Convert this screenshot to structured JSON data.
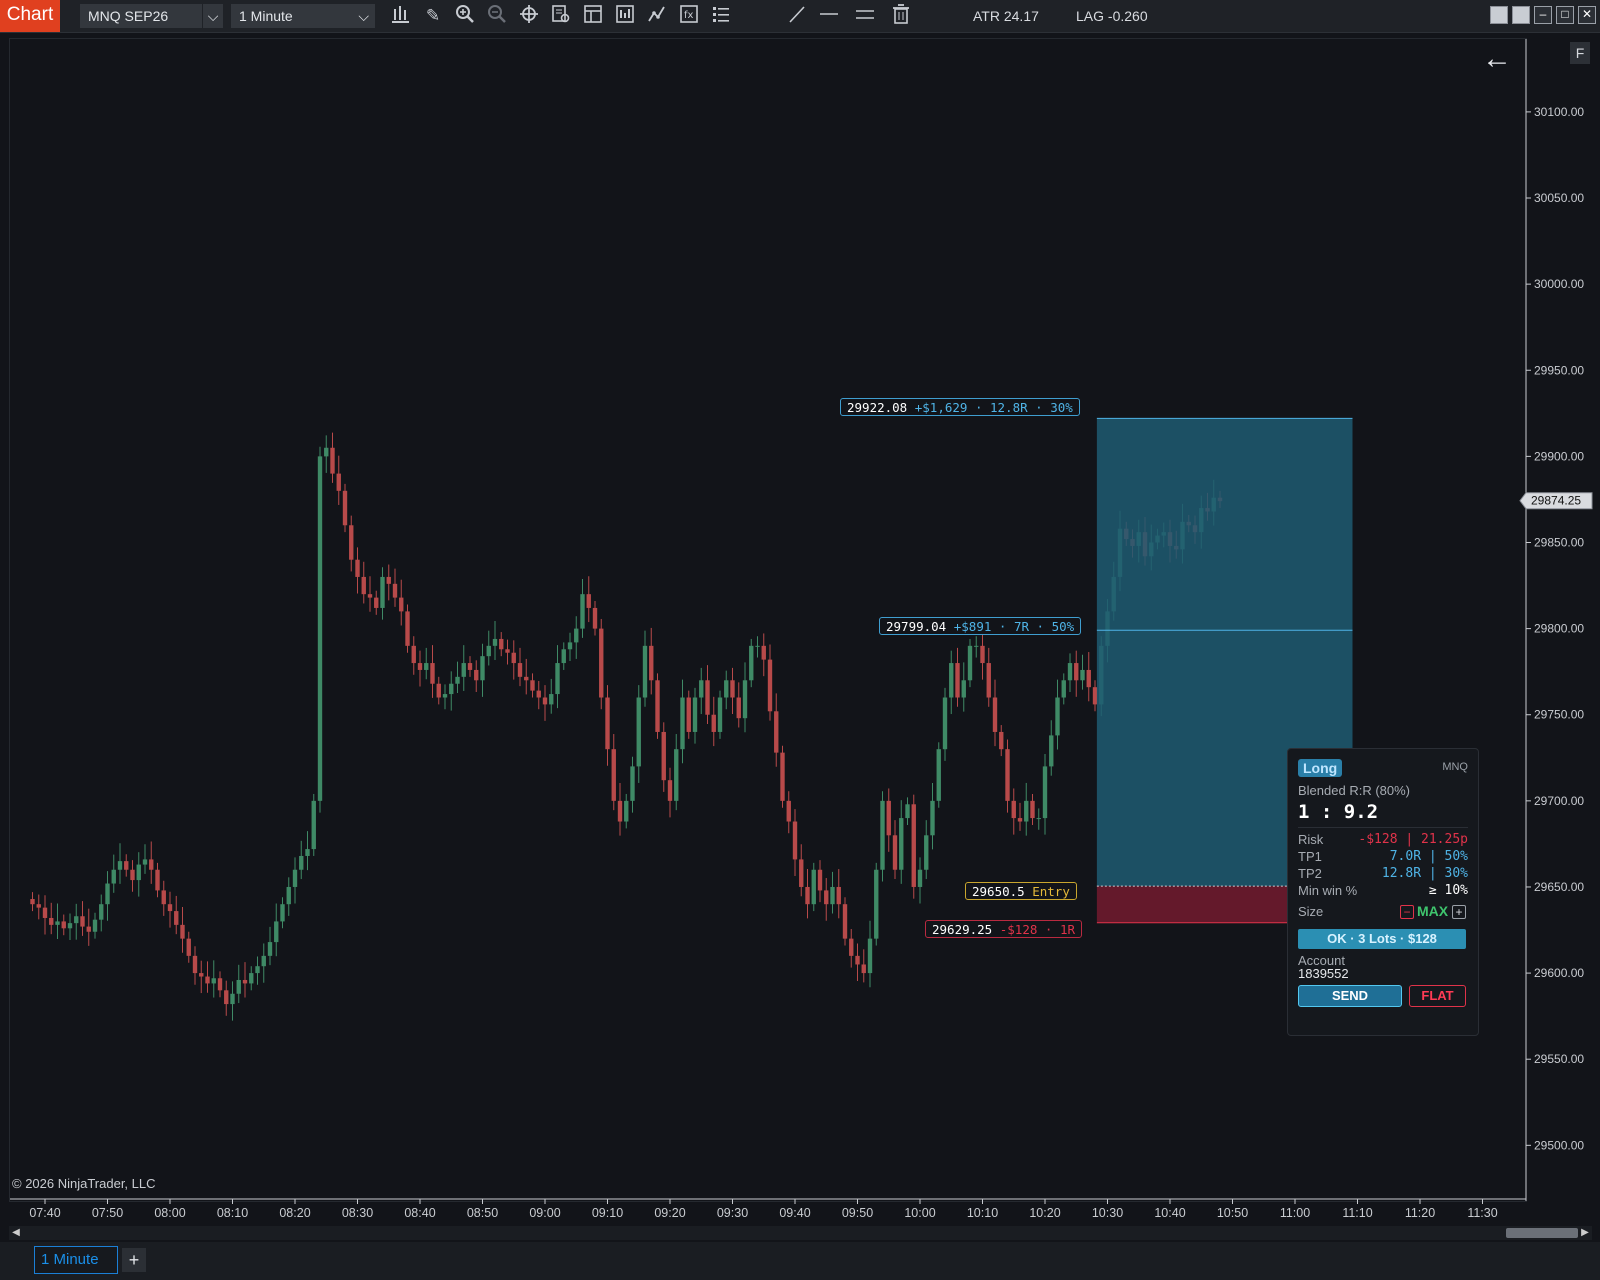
{
  "toolbar": {
    "chart_tab": "Chart",
    "instrument": "MNQ SEP26",
    "interval": "1 Minute",
    "atr": "ATR 24.17",
    "lag": "LAG -0.260",
    "tool_icons": [
      "bars-type-icon",
      "pencil-icon",
      "zoom-in-icon",
      "zoom-out-icon",
      "crosshair-icon",
      "data-box-icon",
      "properties-icon",
      "templates-icon",
      "strategies-icon",
      "indicators-icon",
      "list-icon",
      "draw-line-icon",
      "horizontal-line-icon",
      "double-line-icon",
      "trash-icon"
    ]
  },
  "colors": {
    "up": "#3f8a66",
    "down": "#b84a4a",
    "background": "#121419",
    "target_zone": "#1f5a72",
    "stop_zone": "#6e1a2e",
    "accent_blue": "#4fb3e6",
    "entry_yellow": "#e4b93a",
    "risk_red": "#e0334a"
  },
  "f_button": "F",
  "copyright": "© 2026 NinjaTrader, LLC",
  "bottom": {
    "tab_label": "1 Minute",
    "add_tab": "+"
  },
  "levels": {
    "tp2": {
      "price_text": "29922.08",
      "detail": "+$1,629 · 12.8R · 30%"
    },
    "tp1": {
      "price_text": "29799.04",
      "detail": "+$891 · 7R · 50%"
    },
    "entry": {
      "price_text": "29650.5",
      "detail": "Entry"
    },
    "stop": {
      "price_text": "29629.25",
      "detail": "-$128 · 1R"
    }
  },
  "last_price_label": "29874.25",
  "order_panel": {
    "side": "Long",
    "symbol": "MNQ",
    "blended_label": "Blended R:R (80%)",
    "ratio": "1 : 9.2",
    "risk_label": "Risk",
    "risk_dollars": "-$128",
    "risk_points": "21.25p",
    "tp1_label": "TP1",
    "tp1_r": "7.0R",
    "tp1_pct": "50%",
    "tp2_label": "TP2",
    "tp2_r": "12.8R",
    "tp2_pct": "30%",
    "minwin_label": "Min win %",
    "minwin_value": "≥ 10%",
    "size_label": "Size",
    "size_value": "MAX",
    "size_minus": "−",
    "size_plus": "+",
    "ok_text": "OK · 3 Lots · $128",
    "account_label": "Account",
    "account_value": "1839552",
    "send": "SEND",
    "flat": "FLAT"
  },
  "chart_data": {
    "type": "candlestick",
    "instrument": "MNQ SEP26",
    "interval": "1 Minute",
    "ylim": [
      29470,
      30140
    ],
    "yticks": [
      30100,
      30050,
      30000,
      29950,
      29900,
      29850,
      29800,
      29750,
      29700,
      29650,
      29600,
      29550,
      29500
    ],
    "ytick_labels": [
      "30100.00",
      "30050.00",
      "30000.00",
      "29950.00",
      "29900.00",
      "29850.00",
      "29800.00",
      "29750.00",
      "29700.00",
      "29650.00",
      "29600.00",
      "29550.00",
      "29500.00"
    ],
    "xticks": [
      "07:40",
      "07:50",
      "08:00",
      "08:10",
      "08:20",
      "08:30",
      "08:40",
      "08:50",
      "09:00",
      "09:10",
      "09:20",
      "09:30",
      "09:40",
      "09:50",
      "10:00",
      "10:10",
      "10:20",
      "10:30",
      "10:40",
      "10:50",
      "11:00",
      "11:10",
      "11:20",
      "11:30"
    ],
    "time_start": "07:38",
    "last_close": 29874.25,
    "bars_close": [
      29640,
      29638,
      29632,
      29628,
      29630,
      29626,
      29629,
      29633,
      29627,
      29624,
      29631,
      29640,
      29652,
      29660,
      29665,
      29660,
      29654,
      29663,
      29666,
      29660,
      29648,
      29640,
      29636,
      29628,
      29620,
      29610,
      29600,
      29598,
      29594,
      29597,
      29590,
      29582,
      29588,
      29596,
      29594,
      29600,
      29604,
      29610,
      29618,
      29630,
      29640,
      29650,
      29660,
      29668,
      29672,
      29700,
      29900,
      29905,
      29890,
      29880,
      29860,
      29840,
      29830,
      29820,
      29818,
      29812,
      29830,
      29826,
      29818,
      29810,
      29790,
      29780,
      29776,
      29780,
      29768,
      29760,
      29762,
      29768,
      29772,
      29780,
      29776,
      29770,
      29784,
      29790,
      29794,
      29788,
      29786,
      29780,
      29772,
      29770,
      29764,
      29760,
      29756,
      29762,
      29780,
      29788,
      29792,
      29800,
      29820,
      29812,
      29800,
      29760,
      29730,
      29700,
      29688,
      29700,
      29720,
      29760,
      29790,
      29770,
      29740,
      29712,
      29700,
      29730,
      29760,
      29740,
      29760,
      29770,
      29750,
      29740,
      29760,
      29770,
      29760,
      29748,
      29770,
      29790,
      29790,
      29782,
      29752,
      29728,
      29700,
      29688,
      29666,
      29650,
      29640,
      29660,
      29648,
      29640,
      29650,
      29640,
      29620,
      29610,
      29605,
      29600,
      29620,
      29660,
      29700,
      29680,
      29660,
      29690,
      29698,
      29650,
      29660,
      29680,
      29700,
      29730,
      29760,
      29780,
      29760,
      29770,
      29790,
      29790,
      29780,
      29760,
      29740,
      29730,
      29700,
      29690,
      29688,
      29700,
      29690,
      29690,
      29720,
      29738,
      29760,
      29770,
      29780,
      29770,
      29776,
      29766,
      29756,
      29790,
      29810,
      29830,
      29858,
      29852,
      29848,
      29856,
      29842,
      29850,
      29854,
      29856,
      29848,
      29846,
      29862,
      29860,
      29856,
      29870,
      29868,
      29876,
      29874
    ]
  }
}
